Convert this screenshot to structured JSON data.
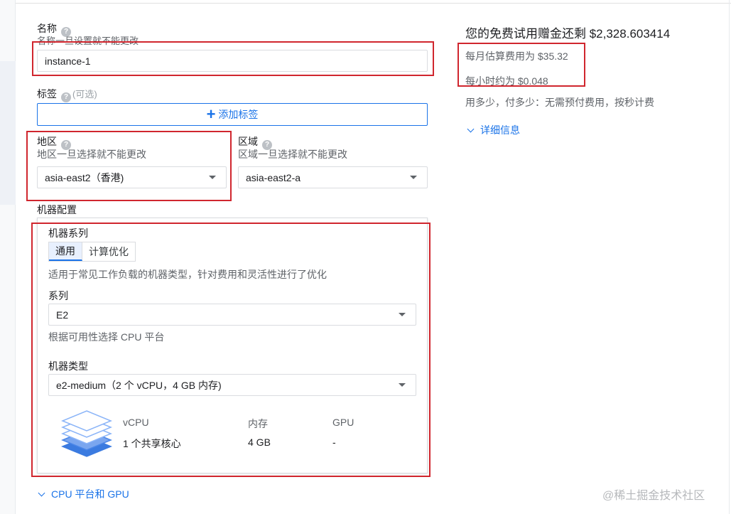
{
  "name_field": {
    "label": "名称",
    "hint": "名称一旦设置就不能更改",
    "value": "instance-1"
  },
  "labels": {
    "label": "标签",
    "optional": "(可选)",
    "add_button": "添加标签"
  },
  "region": {
    "label": "地区",
    "hint": "地区一旦选择就不能更改",
    "value": "asia-east2（香港)"
  },
  "zone": {
    "label": "区域",
    "hint": "区域一旦选择就不能更改",
    "value": "asia-east2-a"
  },
  "machine_config": {
    "title": "机器配置",
    "family_label": "机器系列",
    "tabs": [
      {
        "label": "通用",
        "active": true
      },
      {
        "label": "计算优化",
        "active": false
      }
    ],
    "family_desc": "适用于常见工作负载的机器类型，针对费用和灵活性进行了优化",
    "series_label": "系列",
    "series_value": "E2",
    "series_hint": "根据可用性选择 CPU 平台",
    "type_label": "机器类型",
    "type_value": "e2-medium（2 个 vCPU，4 GB 内存)",
    "specs": {
      "headers": [
        "vCPU",
        "内存",
        "GPU"
      ],
      "values": [
        "1 个共享核心",
        "4 GB",
        "-"
      ]
    }
  },
  "cpu_platform_link": "CPU 平台和 GPU",
  "pricing": {
    "credit": "您的免费试用赠金还剩 $2,328.603414",
    "monthly": "每月估算费用为 $35.32",
    "hourly": "每小时约为 $0.048",
    "note": "用多少，付多少：无需预付费用，按秒计费",
    "details_link": "详细信息"
  },
  "watermark": "@稀土掘金技术社区",
  "colors": {
    "accent": "#1a73e8",
    "highlight_box": "#d0262e"
  },
  "icons": [
    "help-icon",
    "plus-icon",
    "dropdown-caret-icon",
    "chevron-down-icon",
    "layers-icon"
  ]
}
